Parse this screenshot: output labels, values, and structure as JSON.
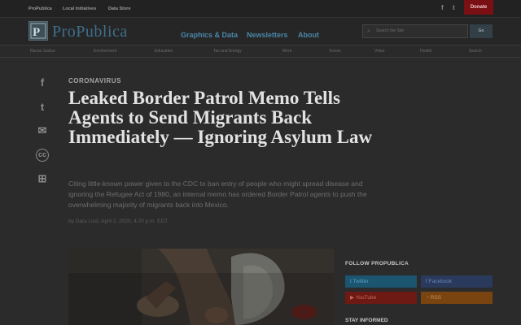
{
  "topbar": {
    "links": [
      "ProPublica",
      "Local Initiatives",
      "Data Store"
    ],
    "facebook_icon": "f",
    "twitter_icon": "t",
    "donate_label": "Donate"
  },
  "header": {
    "logo_text": "ProPublica",
    "nav": [
      "Graphics & Data",
      "Newsletters",
      "About"
    ],
    "search_placeholder": "Search the Site",
    "search_button": "Go"
  },
  "subnav": {
    "items": [
      "Racial Justice",
      "Environment",
      "Education",
      "Tax and Energy",
      "More",
      "Voices",
      "Votes",
      "Health",
      "Search"
    ]
  },
  "share": {
    "icons": [
      "facebook-icon",
      "twitter-icon",
      "email-icon",
      "republish-icon",
      "gift-icon"
    ],
    "glyphs": [
      "f",
      "t",
      "✉",
      "cc",
      "⊞"
    ]
  },
  "article": {
    "kicker": "CORONAVIRUS",
    "headline": "Leaked Border Patrol Memo Tells Agents to Send Migrants Back Immediately — Ignoring Asylum Law",
    "dek": "Citing little-known power given to the CDC to ban entry of people who might spread disease and ignoring the Refugee Act of 1980, an internal memo has ordered Border Patrol agents to push the overwhelming majority of migrants back into Mexico.",
    "byline": "by Dara Lind, April 2, 2020, 4:20 p.m. EDT"
  },
  "sidebar": {
    "follow_title": "FOLLOW PROPUBLICA",
    "social": [
      {
        "label": "Twitter",
        "color": "#1c5570",
        "text_color": "#5aa0c8"
      },
      {
        "label": "Facebook",
        "color": "#2a3a5c",
        "text_color": "#6a86b8"
      },
      {
        "label": "YouTube",
        "color": "#6e1a14",
        "text_color": "#c86a5a"
      },
      {
        "label": "RSS",
        "color": "#7a4410",
        "text_color": "#c8905a"
      }
    ],
    "stay_title": "STAY INFORMED"
  }
}
